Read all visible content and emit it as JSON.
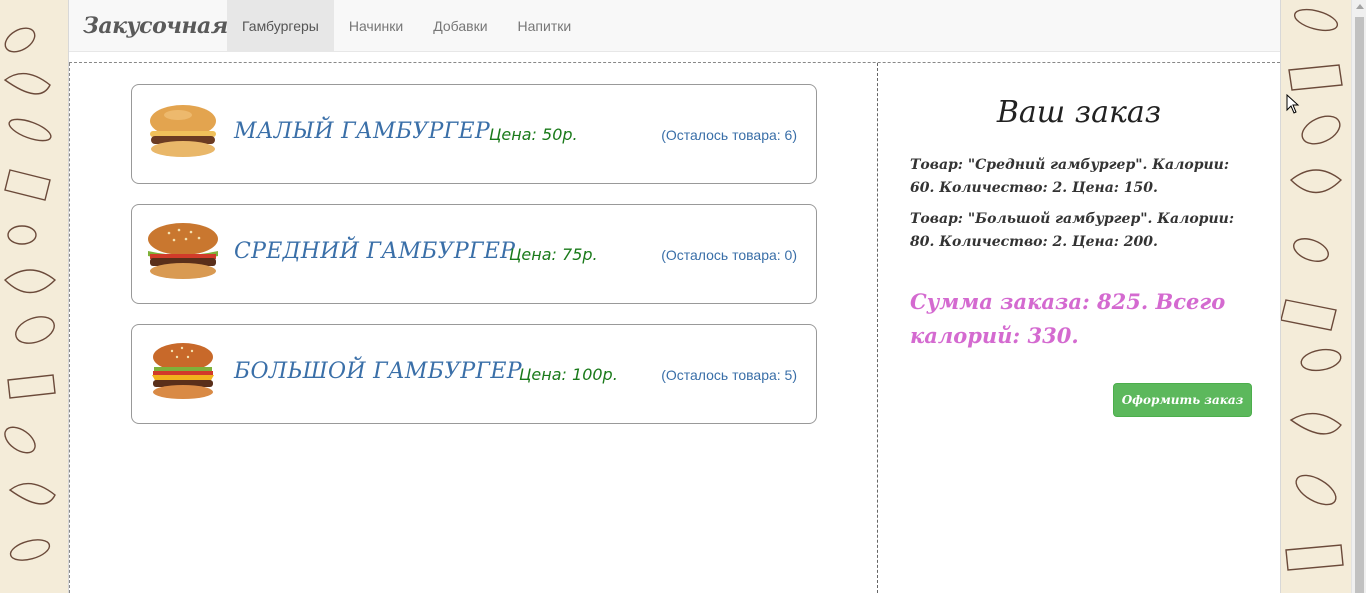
{
  "brand": "Закусочная",
  "nav": {
    "items": [
      "Гамбургеры",
      "Начинки",
      "Добавки",
      "Напитки"
    ],
    "active_index": 0
  },
  "products": [
    {
      "name": "МАЛЫЙ ГАМБУРГЕР",
      "price": "Цена: 50р.",
      "stock": "(Осталось товара: 6)",
      "icon": "small-burger-image"
    },
    {
      "name": "СРЕДНИЙ ГАМБУРГЕР",
      "price": "Цена: 75р.",
      "stock": "(Осталось товара: 0)",
      "icon": "medium-burger-image"
    },
    {
      "name": "БОЛЬШОЙ ГАМБУРГЕР",
      "price": "Цена: 100р.",
      "stock": "(Осталось товара: 5)",
      "icon": "big-burger-image"
    }
  ],
  "order": {
    "title": "Ваш заказ",
    "lines": [
      "Товар: \"Средний гамбургер\". Калории: 60. Количество: 2. Цена: 150.",
      "Товар: \"Большой гамбургер\". Калории: 80. Количество: 2. Цена: 200."
    ],
    "summary": "Сумма заказа: 825. Всего калорий: 330.",
    "button_label": "Оформить заказ"
  },
  "colors": {
    "product_name": "#3a6fa8",
    "price": "#1a7a1a",
    "summary": "#d46ad0",
    "button": "#5cb85c",
    "background_pattern": "#f4ecd9"
  }
}
